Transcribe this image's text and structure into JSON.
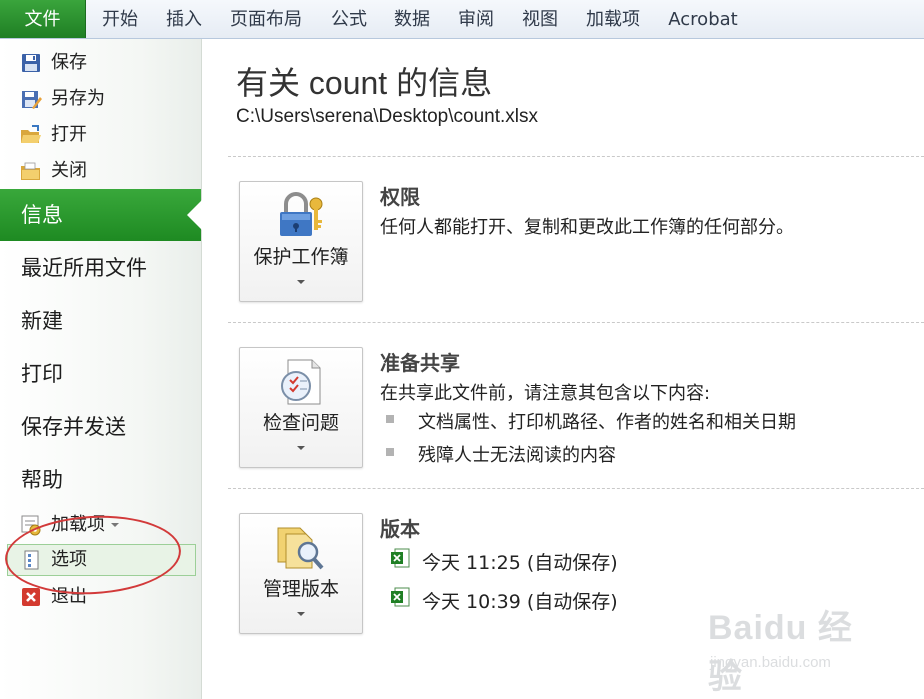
{
  "ribbon": {
    "file_tab": "文件",
    "tabs": [
      "开始",
      "插入",
      "页面布局",
      "公式",
      "数据",
      "审阅",
      "视图",
      "加载项",
      "Acrobat"
    ]
  },
  "nav": {
    "save": "保存",
    "save_as": "另存为",
    "open": "打开",
    "close": "关闭",
    "info": "信息",
    "recent": "最近所用文件",
    "new": "新建",
    "print": "打印",
    "save_send": "保存并发送",
    "help": "帮助",
    "addins": "加载项",
    "options": "选项",
    "exit": "退出"
  },
  "main": {
    "title": "有关 count 的信息",
    "path": "C:\\Users\\serena\\Desktop\\count.xlsx",
    "permissions": {
      "button": "保护工作簿",
      "heading": "权限",
      "desc": "任何人都能打开、复制和更改此工作簿的任何部分。"
    },
    "prepare": {
      "button": "检查问题",
      "heading": "准备共享",
      "desc": "在共享此文件前，请注意其包含以下内容:",
      "items": [
        "文档属性、打印机路径、作者的姓名和相关日期",
        "残障人士无法阅读的内容"
      ]
    },
    "versions": {
      "button": "管理版本",
      "heading": "版本",
      "items": [
        "今天 11:25 (自动保存)",
        "今天 10:39 (自动保存)"
      ]
    }
  },
  "watermark": {
    "logo": "Baidu 经验",
    "url": "jingyan.baidu.com"
  },
  "colors": {
    "file_green": "#1f7f24",
    "annotation_red": "#d23a3a"
  }
}
